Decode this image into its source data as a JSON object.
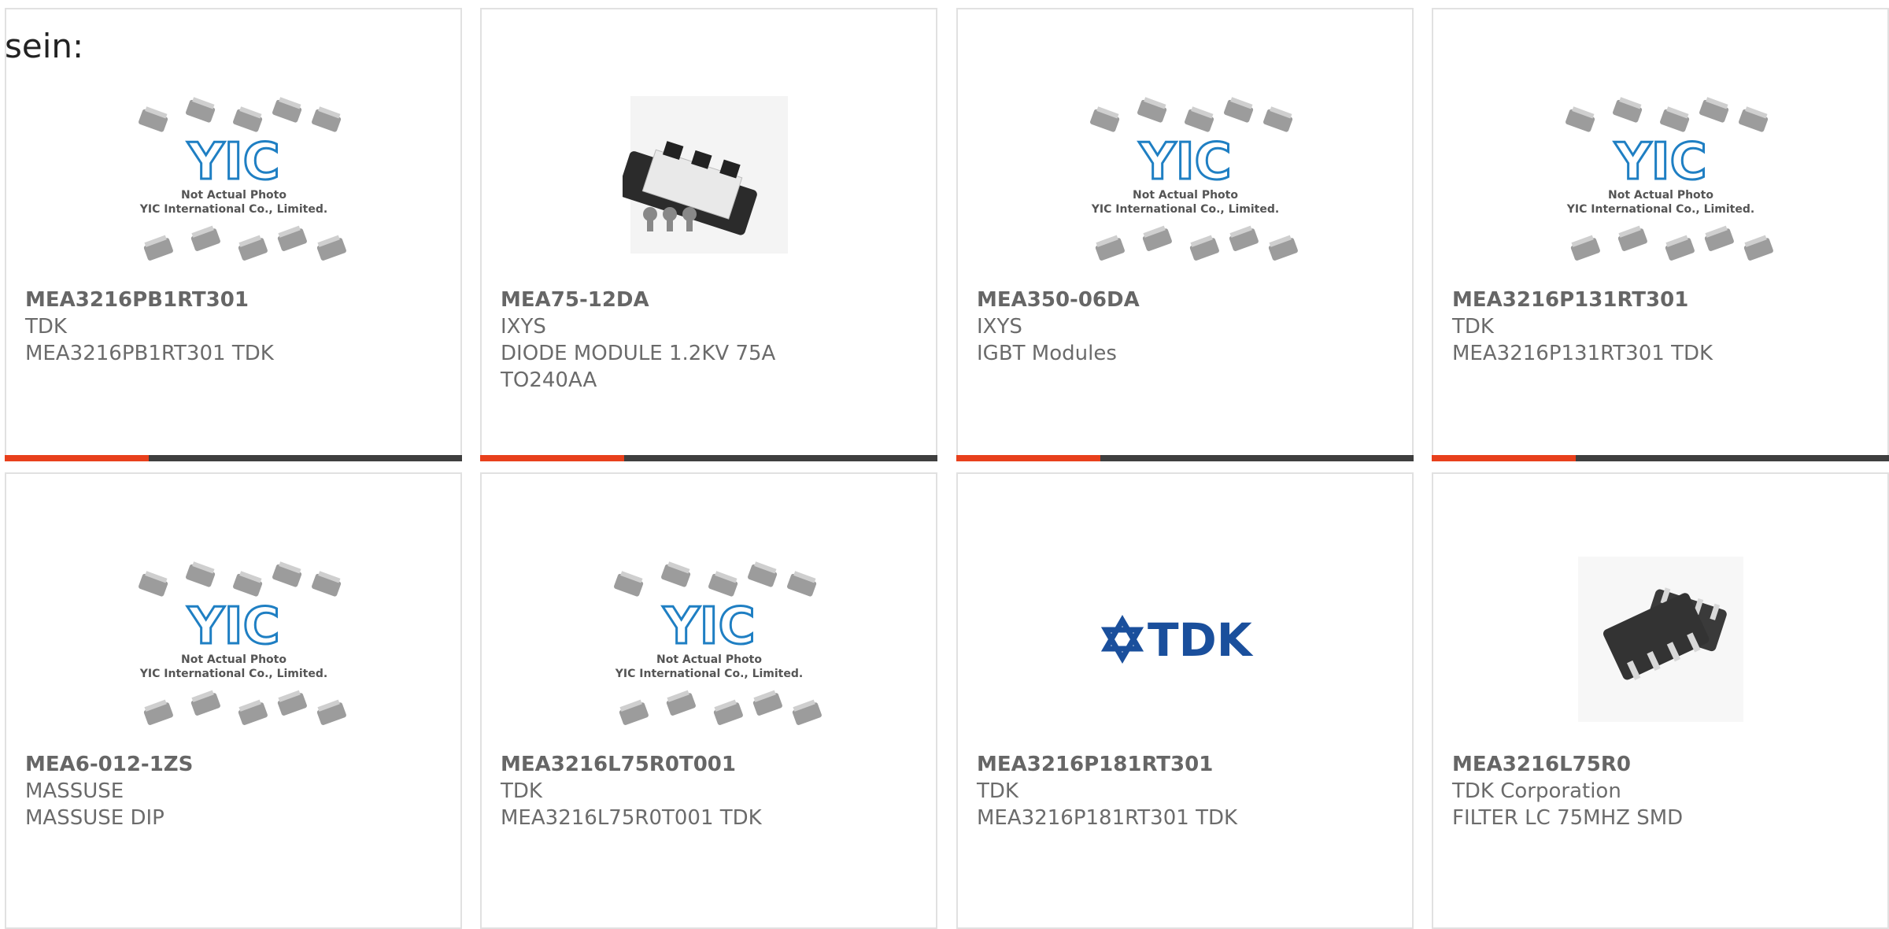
{
  "intro_text": "sein:",
  "products": [
    {
      "part": "MEA3216PB1RT301",
      "maker": "TDK",
      "desc": [
        "MEA3216PB1RT301 TDK"
      ],
      "image": "placeholder-photo"
    },
    {
      "part": "MEA75-12DA",
      "maker": "IXYS",
      "desc": [
        "DIODE MODULE 1.2KV 75A",
        "TO240AA"
      ],
      "image": "diode-module-photo"
    },
    {
      "part": "MEA350-06DA",
      "maker": "IXYS",
      "desc": [
        "IGBT Modules"
      ],
      "image": "placeholder-photo"
    },
    {
      "part": "MEA3216P131RT301",
      "maker": "TDK",
      "desc": [
        "MEA3216P131RT301 TDK"
      ],
      "image": "placeholder-photo"
    },
    {
      "part": "MEA6-012-1ZS",
      "maker": "MASSUSE",
      "desc": [
        "MASSUSE DIP"
      ],
      "image": "placeholder-photo"
    },
    {
      "part": "MEA3216L75R0T001",
      "maker": "TDK",
      "desc": [
        "MEA3216L75R0T001 TDK"
      ],
      "image": "placeholder-photo"
    },
    {
      "part": "MEA3216P181RT301",
      "maker": "TDK",
      "desc": [
        "MEA3216P181RT301 TDK"
      ],
      "image": "tdk-logo"
    },
    {
      "part": "MEA3216L75R0",
      "maker": "TDK Corporation",
      "desc": [
        "FILTER LC 75MHZ SMD"
      ],
      "image": "smd-filter-photo"
    }
  ],
  "placeholder": {
    "logo_text": "YIC",
    "caption_line1": "Not Actual Photo",
    "caption_line2": "YIC International Co., Limited."
  },
  "tdk_logo_text": "TDK",
  "colors": {
    "accent": "#e8401c",
    "bar": "#3f3f3f",
    "text": "#6b6b6b",
    "border": "#e1e1e1",
    "yic_blue": "#1f7fc3",
    "tdk_blue": "#1a4f9c"
  }
}
